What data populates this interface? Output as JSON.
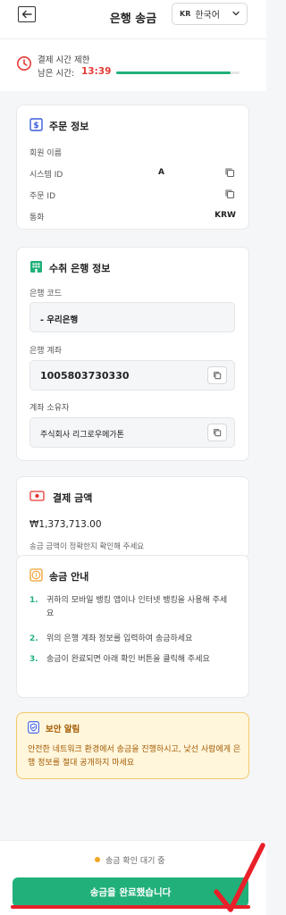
{
  "header": {
    "title": "은행 송금",
    "lang_code": "KR",
    "lang_name": "한국어"
  },
  "timer": {
    "title": "결제 시간 제한",
    "remaining_label": "남은 시간:",
    "remaining_value": "13:39",
    "progress": 0.93
  },
  "order": {
    "title": "주문 정보",
    "rows": [
      {
        "label": "회원 이름",
        "value": ""
      },
      {
        "label": "시스템 ID",
        "value": "A"
      },
      {
        "label": "주문 ID",
        "value": ""
      },
      {
        "label": "통화",
        "value": "KRW"
      }
    ]
  },
  "bank": {
    "title": "수취 은행 정보",
    "code_label": "은행 코드",
    "code_value": "- 우리은행",
    "account_label": "은행 계좌",
    "account_value": "1005803730330",
    "holder_label": "계좌 소유자",
    "holder_value": "주식회사 리그로우메가톤"
  },
  "amount": {
    "title": "결제 금액",
    "value": "₩1,373,713.00",
    "note": "송금 금액이 정확한지 확인해 주세요"
  },
  "guide": {
    "title": "송금 안내",
    "steps": [
      {
        "num": "1.",
        "text": "귀하의 모바일 뱅킹 앱이나 인터넷 뱅킹을 사용해 주세요"
      },
      {
        "num": "2.",
        "text": "위의 은행 계좌 정보를 입력하여 송금하세요"
      },
      {
        "num": "3.",
        "text": "송금이 완료되면 아래 확인 버튼을 클릭해 주세요"
      }
    ]
  },
  "alert": {
    "title": "보안 알림",
    "text": "안전한 네트워크 환경에서 송금을 진행하시고, 낯선 사람에게 은행 정보를 절대 공개하지 마세요"
  },
  "footer": {
    "status": "송금 확인 대기 중",
    "button": "송금을 완료했습니다"
  },
  "colors": {
    "accent": "#21b07a",
    "timer_red": "#e53935",
    "alert_bg": "#fff6dc",
    "alert_text": "#a35a00",
    "status_dot": "#f5a623",
    "annotation_red": "#e8202a"
  },
  "icons": {
    "back": "arrow-left-icon",
    "lang": "chevron-down-icon",
    "timer": "clock-icon",
    "order": "dollar-doc-icon",
    "bank": "building-icon",
    "amount": "banknote-icon",
    "guide": "info-icon",
    "alert": "shield-icon",
    "copy": "copy-icon"
  }
}
